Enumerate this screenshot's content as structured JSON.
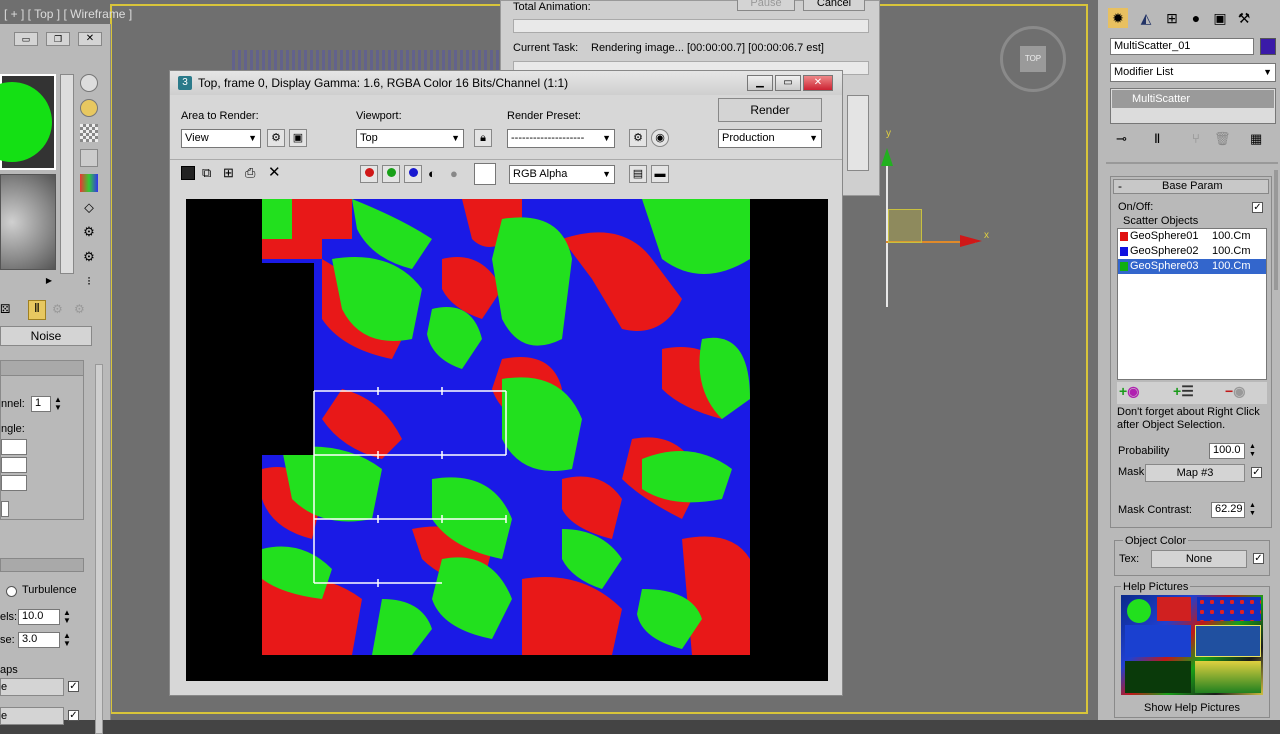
{
  "viewport": {
    "label": "[ + ] [ Top ] [ Wireframe ]",
    "gizmo_label": "TOP",
    "axis_y": "y",
    "axis_x": "x"
  },
  "material_panel": {
    "noise_button": "Noise",
    "channel_label": "nnel:",
    "channel_value": "1",
    "angle_label": "ngle:",
    "turbulence_label": "Turbulence",
    "levels_label": "els:",
    "levels_value": "10.0",
    "size_label": "se:",
    "size_value": "3.0",
    "maps_label": "aps",
    "map_row_1": "e",
    "map_row_2": "e"
  },
  "progress_dialog": {
    "total_animation_label": "Total Animation:",
    "pause_button": "Pause",
    "cancel_button": "Cancel",
    "current_task_label": "Current Task:",
    "current_task_value": "Rendering image... [00:00:00.7] [00:00:06.7 est]"
  },
  "frame_window": {
    "title": "Top, frame 0, Display Gamma: 1.6, RGBA Color 16 Bits/Channel (1:1)",
    "area_to_render_label": "Area to Render:",
    "area_to_render_value": "View",
    "viewport_label": "Viewport:",
    "viewport_value": "Top",
    "render_preset_label": "Render Preset:",
    "render_preset_value": "--------------------",
    "render_button": "Render",
    "production_value": "Production",
    "channel_display_value": "RGB Alpha"
  },
  "command_panel": {
    "object_name": "MultiScatter_01",
    "object_color": "#3a1aa8",
    "modifier_list": "Modifier List",
    "stack_item": "MultiScatter",
    "rollout_title": "Base Param",
    "on_off_label": "On/Off:",
    "on_off_checked": "✓",
    "scatter_objects_label": "Scatter Objects",
    "scatter_objects": [
      {
        "name": "GeoSphere01",
        "size": "100.Cm",
        "color": "#e01010"
      },
      {
        "name": "GeoSphere02",
        "size": "100.Cm",
        "color": "#1010e0"
      },
      {
        "name": "GeoSphere03",
        "size": "100.Cm",
        "color": "#10b010"
      }
    ],
    "hint_text": "Don't forget about Right Click after Object Selection.",
    "probability_label": "Probability",
    "probability_value": "100.0",
    "mask_label": "Mask",
    "mask_map": "Map #3",
    "mask_contrast_label": "Mask Contrast:",
    "mask_contrast_value": "62.29",
    "object_color_label": "Object Color",
    "tex_label": "Tex:",
    "tex_value": "None",
    "help_pictures_label": "Help Pictures",
    "show_help_button": "Show Help Pictures"
  },
  "colors": {
    "red": "#e81818",
    "green": "#22e01e",
    "blue": "#1a1ae6",
    "viewport_border": "#d8c43a"
  }
}
